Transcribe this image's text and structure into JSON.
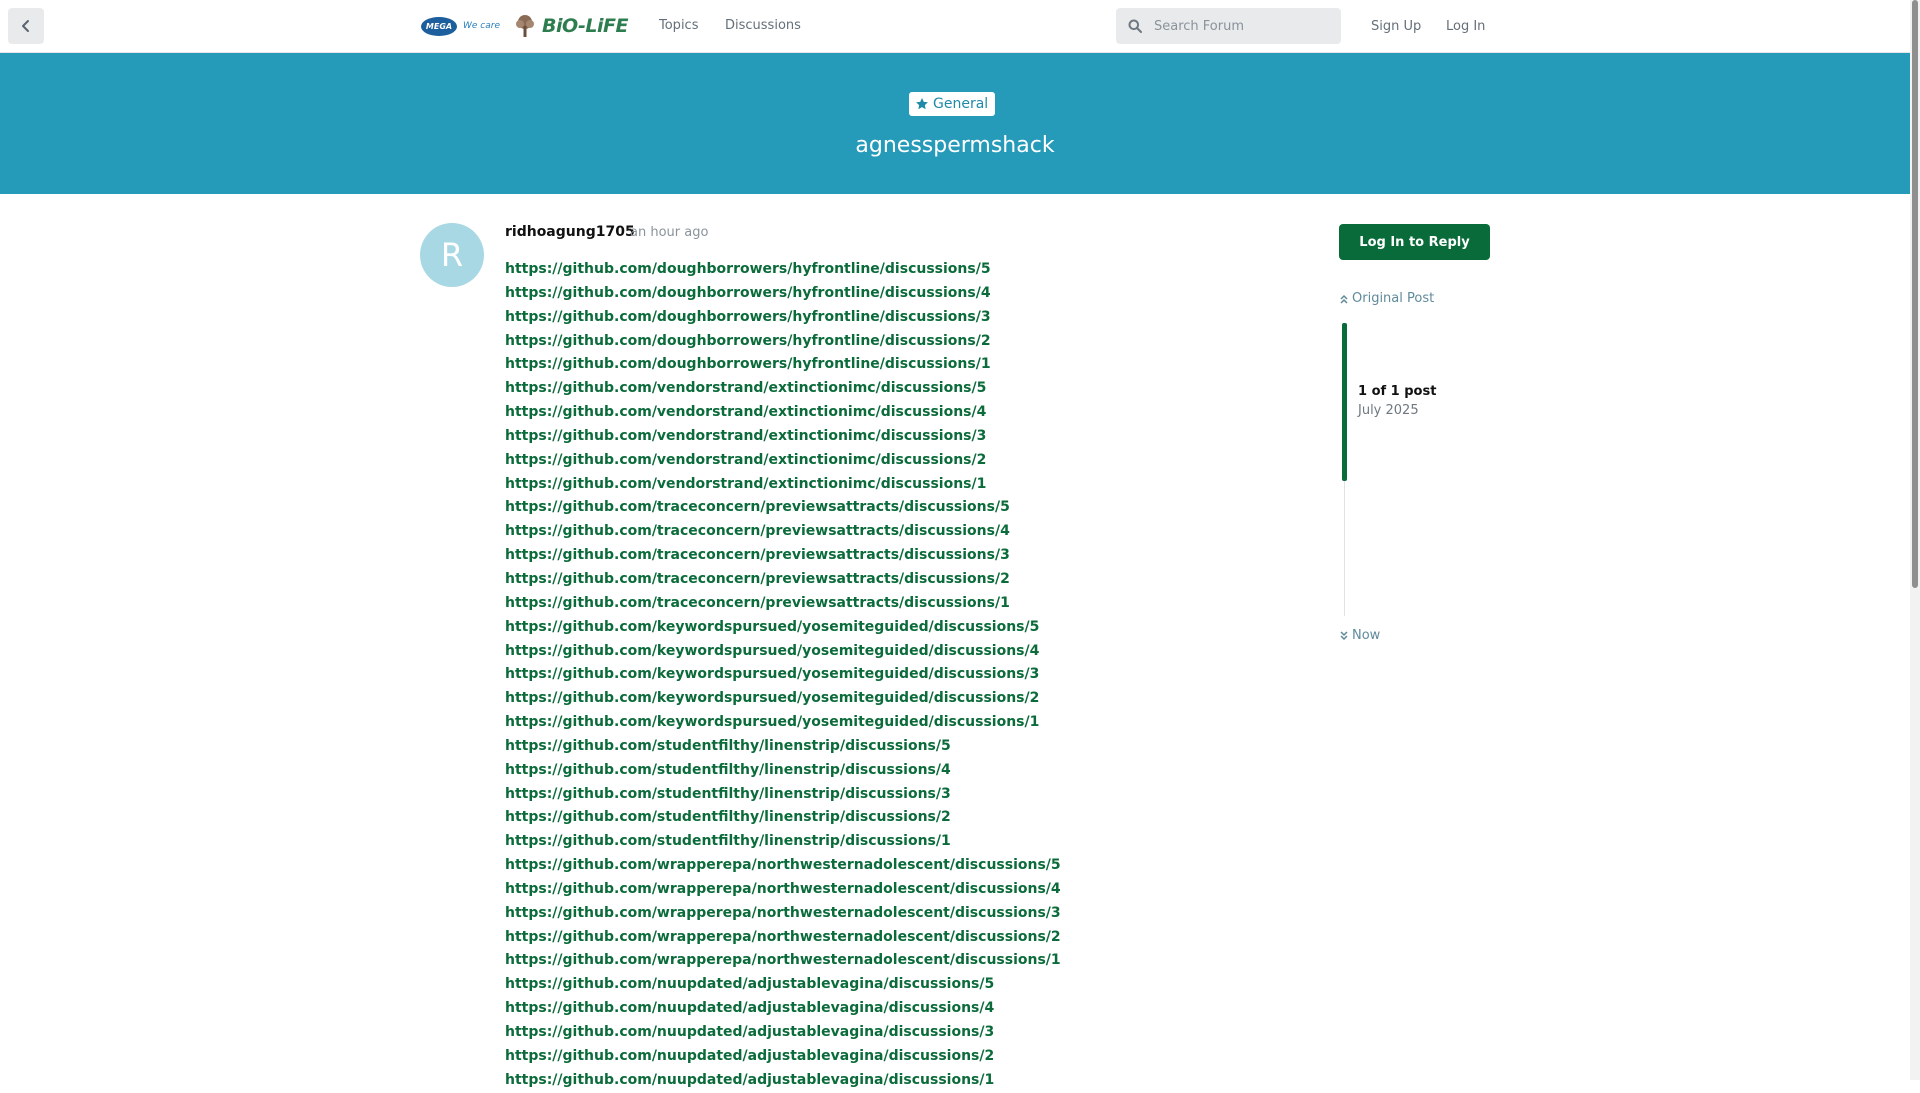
{
  "header": {
    "back_icon": "chevron-left-icon",
    "logo": {
      "mega_text": "MEGA",
      "mega_tag": "We care",
      "brand": "BiO-LiFE"
    },
    "nav": [
      {
        "label": "Topics"
      },
      {
        "label": "Discussions"
      }
    ],
    "search": {
      "placeholder": "Search Forum",
      "icon": "search-icon"
    },
    "auth": {
      "sign_up": "Sign Up",
      "log_in": "Log In"
    }
  },
  "colors": {
    "hero": "#259bb9",
    "link": "#0b6b3a",
    "primary_button": "#0a6b3a"
  },
  "hero": {
    "tag": {
      "label": "General",
      "icon": "star-icon"
    },
    "title": "agnesspermshack"
  },
  "post": {
    "avatar_letter": "R",
    "author": "ridhoagung1705",
    "time": "an hour ago",
    "links": [
      "https://github.com/doughborrowers/hyfrontline/discussions/5",
      "https://github.com/doughborrowers/hyfrontline/discussions/4",
      "https://github.com/doughborrowers/hyfrontline/discussions/3",
      "https://github.com/doughborrowers/hyfrontline/discussions/2",
      "https://github.com/doughborrowers/hyfrontline/discussions/1",
      "https://github.com/vendorstrand/extinctionimc/discussions/5",
      "https://github.com/vendorstrand/extinctionimc/discussions/4",
      "https://github.com/vendorstrand/extinctionimc/discussions/3",
      "https://github.com/vendorstrand/extinctionimc/discussions/2",
      "https://github.com/vendorstrand/extinctionimc/discussions/1",
      "https://github.com/traceconcern/previewsattracts/discussions/5",
      "https://github.com/traceconcern/previewsattracts/discussions/4",
      "https://github.com/traceconcern/previewsattracts/discussions/3",
      "https://github.com/traceconcern/previewsattracts/discussions/2",
      "https://github.com/traceconcern/previewsattracts/discussions/1",
      "https://github.com/keywordspursued/yosemiteguided/discussions/5",
      "https://github.com/keywordspursued/yosemiteguided/discussions/4",
      "https://github.com/keywordspursued/yosemiteguided/discussions/3",
      "https://github.com/keywordspursued/yosemiteguided/discussions/2",
      "https://github.com/keywordspursued/yosemiteguided/discussions/1",
      "https://github.com/studentfilthy/linenstrip/discussions/5",
      "https://github.com/studentfilthy/linenstrip/discussions/4",
      "https://github.com/studentfilthy/linenstrip/discussions/3",
      "https://github.com/studentfilthy/linenstrip/discussions/2",
      "https://github.com/studentfilthy/linenstrip/discussions/1",
      "https://github.com/wrapperepa/northwesternadolescent/discussions/5",
      "https://github.com/wrapperepa/northwesternadolescent/discussions/4",
      "https://github.com/wrapperepa/northwesternadolescent/discussions/3",
      "https://github.com/wrapperepa/northwesternadolescent/discussions/2",
      "https://github.com/wrapperepa/northwesternadolescent/discussions/1",
      "https://github.com/nuupdated/adjustablevagina/discussions/5",
      "https://github.com/nuupdated/adjustablevagina/discussions/4",
      "https://github.com/nuupdated/adjustablevagina/discussions/3",
      "https://github.com/nuupdated/adjustablevagina/discussions/2",
      "https://github.com/nuupdated/adjustablevagina/discussions/1"
    ]
  },
  "sidebar": {
    "reply_button": "Log In to Reply",
    "original_post": "Original Post",
    "post_count": "1 of 1 post",
    "date": "July 2025",
    "now": "Now"
  }
}
